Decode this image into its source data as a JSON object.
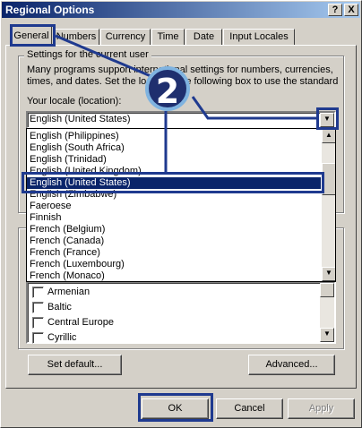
{
  "window": {
    "title": "Regional Options",
    "help_btn": "?",
    "close_btn": "X"
  },
  "tabs": [
    {
      "label": "General"
    },
    {
      "label": "Numbers"
    },
    {
      "label": "Currency"
    },
    {
      "label": "Time"
    },
    {
      "label": "Date"
    },
    {
      "label": "Input Locales"
    }
  ],
  "settings_group": {
    "label": "Settings for the current user",
    "desc_line1": "Many programs support international settings for numbers, currencies,",
    "desc_line2": "times, and dates. Set the locale in the following box to use the standard settings.",
    "locale_label": "Your locale (location):",
    "locale_value": "English (United States)"
  },
  "locale_list": {
    "items": [
      "English (Philippines)",
      "English (South Africa)",
      "English (Trinidad)",
      "English (United Kingdom)",
      "English (United States)",
      "English (Zimbabwe)",
      "Faeroese",
      "Finnish",
      "French (Belgium)",
      "French (Canada)",
      "French (France)",
      "French (Luxembourg)",
      "French (Monaco)"
    ],
    "selected": "English (United States)"
  },
  "language_group": {
    "items": [
      "Armenian",
      "Baltic",
      "Central Europe",
      "Cyrillic"
    ]
  },
  "buttons": {
    "set_default": "Set default...",
    "advanced": "Advanced...",
    "ok": "OK",
    "cancel": "Cancel",
    "apply": "Apply"
  },
  "annotation": {
    "step_number": "2",
    "color": "#1f3a8f"
  }
}
